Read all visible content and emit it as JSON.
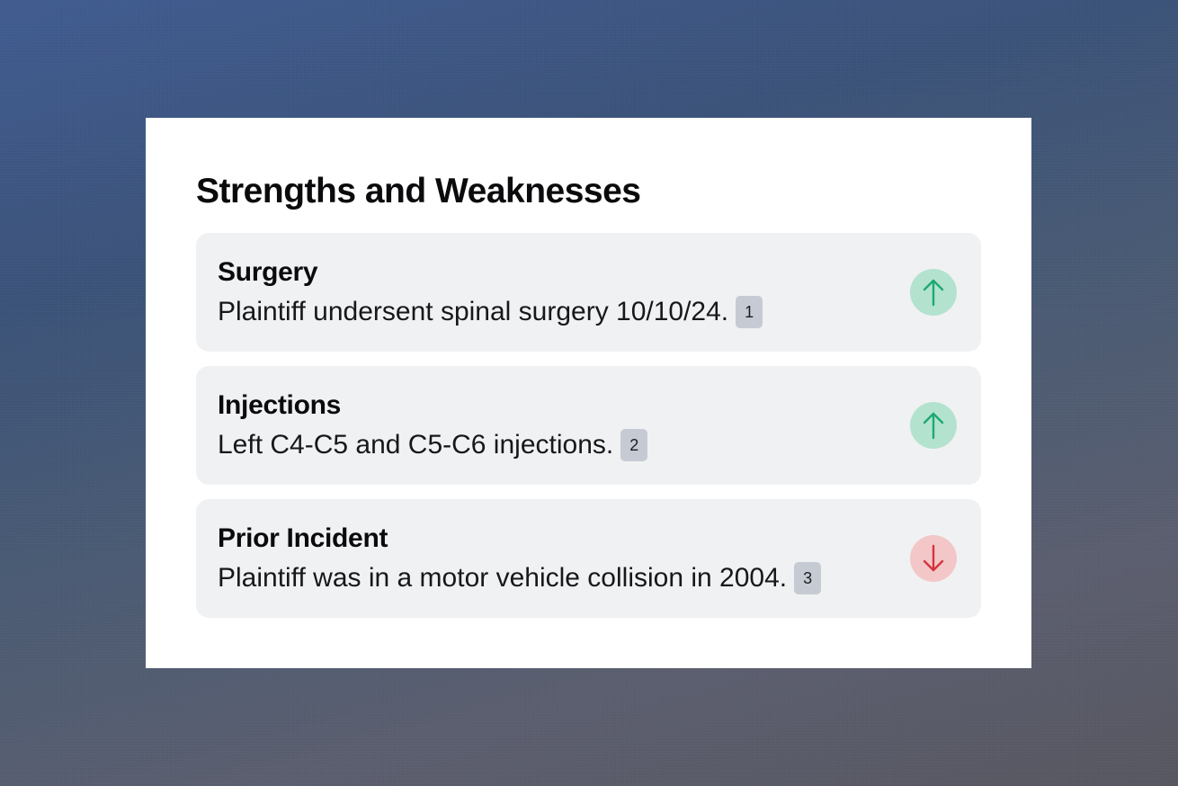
{
  "card": {
    "title": "Strengths and Weaknesses"
  },
  "items": [
    {
      "title": "Surgery",
      "description": "Plaintiff undersent spinal surgery 10/10/24.",
      "citation": "1",
      "direction": "up",
      "icon": "arrow-up-icon",
      "color": "#1ea872"
    },
    {
      "title": "Injections",
      "description": "Left C4-C5 and C5-C6 injections.",
      "citation": "2",
      "direction": "up",
      "icon": "arrow-up-icon",
      "color": "#1ea872"
    },
    {
      "title": "Prior Incident",
      "description": "Plaintiff was in a motor vehicle collision in 2004.",
      "citation": "3",
      "direction": "down",
      "icon": "arrow-down-icon",
      "color": "#d4343f"
    }
  ]
}
